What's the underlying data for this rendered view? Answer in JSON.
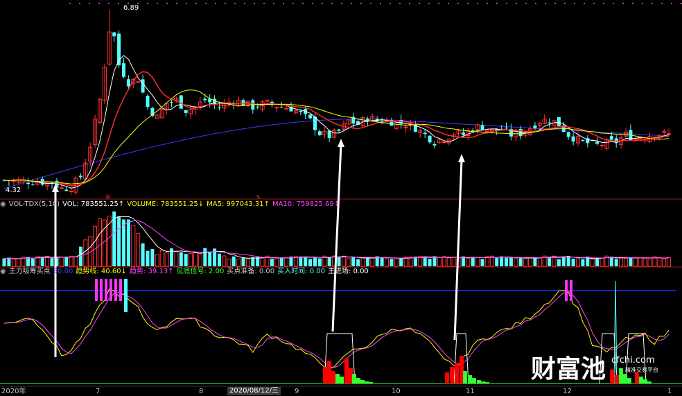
{
  "colors": {
    "background": "#000000",
    "up": "#ff3232",
    "down": "#54ffff",
    "ma5": "#ffffff",
    "ma10": "#ff2a2a",
    "ma20": "#ffff00",
    "ma60": "#3a3aff",
    "vol_ma5": "#ffffff",
    "vol_ma10": "#ff44ff",
    "trend_line": "#ffff00",
    "trend_vol": "#ff44ff",
    "signal_magenta": "#ff33ff",
    "signal_red": "#ff0000",
    "signal_green": "#33ff33",
    "blue_level": "#2a2aff",
    "divider": "#8b1a1a"
  },
  "price_panel": {
    "high_label": "6.89",
    "low_label": "4.32"
  },
  "volume_panel": {
    "indicator_name": "VOL-TDX(5,10)",
    "vol_label": "VOL: 783551.25↑",
    "volume_label": "VOLUME: 783551.25↓",
    "ma5_label": "MA5: 997043.31↑",
    "ma10_label": "MA10: 759825.69↑"
  },
  "indicator_panel": {
    "name": "主力吸筹买点",
    "value0": "50.00",
    "trend_line_label": "趋势线: 40.60↓",
    "trend_label": "趋势: 39.13↑",
    "bottom_signal_label": "见底信号: 2.00",
    "buy_prep_label": "买点准备: 0.00",
    "buy_time_label": "买入时间: 0.00",
    "main_entry_label": "主进场: 0.00"
  },
  "date_axis": {
    "year_label": "2020年",
    "months": [
      "7",
      "8",
      "9",
      "10",
      "11",
      "12",
      "1"
    ],
    "cursor_date": "2020/08/12/三"
  },
  "watermark": {
    "brand": "财富池",
    "url": "cfchi.com",
    "subtitle": "精准交易平台"
  },
  "chart_data": {
    "type": "candlestick",
    "notes_marks": [
      "补",
      "S"
    ],
    "arrows": 3
  }
}
